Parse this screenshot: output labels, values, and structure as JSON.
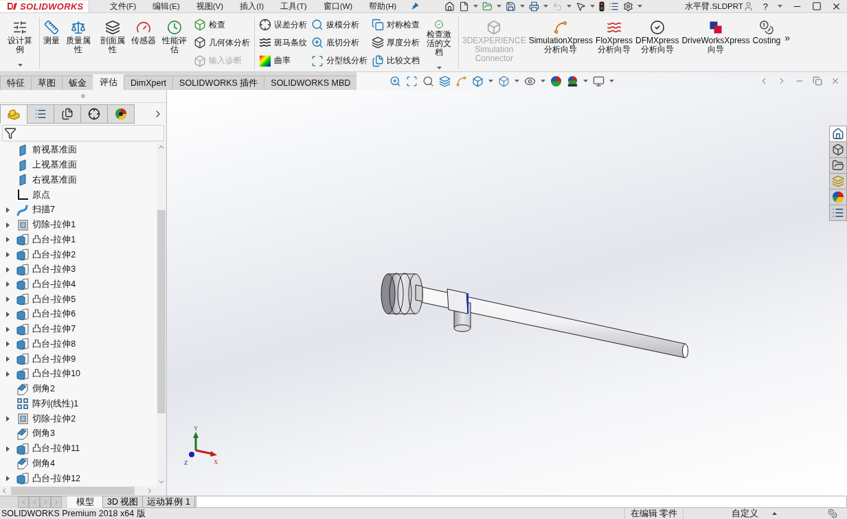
{
  "title_bar": {
    "logo": "SOLIDWORKS",
    "menus": [
      "文件(F)",
      "编辑(E)",
      "视图(V)",
      "插入(I)",
      "工具(T)",
      "窗口(W)",
      "帮助(H)"
    ],
    "document": "水平臂.SLDPRT",
    "help": "?"
  },
  "ribbon": [
    {
      "kind": "large",
      "label": "设计算例",
      "dropdown": true,
      "disabled": false
    },
    {
      "kind": "separator"
    },
    {
      "kind": "large",
      "label": "测量",
      "dropdown": false,
      "disabled": false
    },
    {
      "kind": "large",
      "label": "质量属性",
      "dropdown": false,
      "disabled": false
    },
    {
      "kind": "large",
      "label": "剖面属性",
      "dropdown": false,
      "disabled": false
    },
    {
      "kind": "large",
      "label": "传感器",
      "dropdown": false,
      "disabled": false
    },
    {
      "kind": "large",
      "label": "性能评估",
      "dropdown": false,
      "disabled": false
    },
    {
      "kind": "stack",
      "items": [
        {
          "label": "检查",
          "disabled": false
        },
        {
          "label": "几何体分析",
          "disabled": false
        },
        {
          "label": "输入诊断",
          "disabled": true
        }
      ]
    },
    {
      "kind": "separator"
    },
    {
      "kind": "stack",
      "items": [
        {
          "label": "误差分析",
          "disabled": false
        },
        {
          "label": "斑马条纹",
          "disabled": false
        },
        {
          "label": "曲率",
          "disabled": false
        }
      ]
    },
    {
      "kind": "stack",
      "items": [
        {
          "label": "拔模分析",
          "disabled": false
        },
        {
          "label": "底切分析",
          "disabled": false
        },
        {
          "label": "分型线分析",
          "disabled": false
        }
      ]
    },
    {
      "kind": "stack",
      "items": [
        {
          "label": "对称检查",
          "disabled": false
        },
        {
          "label": "厚度分析",
          "disabled": false
        },
        {
          "label": "比较文档",
          "disabled": false
        }
      ]
    },
    {
      "kind": "large",
      "label": "检查激活的文档",
      "dropdown": true,
      "disabled": false
    },
    {
      "kind": "separator"
    },
    {
      "kind": "large",
      "label": "3DEXPERIENCE Simulation Connector",
      "dropdown": false,
      "disabled": true
    },
    {
      "kind": "large",
      "label": "SimulationXpress 分析向导",
      "dropdown": false,
      "disabled": false
    },
    {
      "kind": "large",
      "label": "FloXpress 分析向导",
      "dropdown": false,
      "disabled": false
    },
    {
      "kind": "large",
      "label": "DFMXpress 分析向导",
      "dropdown": false,
      "disabled": false
    },
    {
      "kind": "large",
      "label": "DriveWorksXpress 向导",
      "dropdown": false,
      "disabled": false
    },
    {
      "kind": "large",
      "label": "Costing",
      "dropdown": false,
      "disabled": false
    }
  ],
  "ribbon_more": "»",
  "command_tabs": [
    {
      "label": "特征",
      "selected": false
    },
    {
      "label": "草图",
      "selected": false
    },
    {
      "label": "钣金",
      "selected": false
    },
    {
      "label": "评估",
      "selected": true
    },
    {
      "label": "DimXpert",
      "selected": false
    },
    {
      "label": "SOLIDWORKS 插件",
      "selected": false
    },
    {
      "label": "SOLIDWORKS MBD",
      "selected": false
    }
  ],
  "panel_tabs": [
    {
      "selected": true
    },
    {
      "selected": false
    },
    {
      "selected": false
    },
    {
      "selected": false
    },
    {
      "selected": false
    }
  ],
  "tree": [
    {
      "label": "前视基准面",
      "kind": "plane",
      "expandable": false
    },
    {
      "label": "上视基准面",
      "kind": "plane",
      "expandable": false
    },
    {
      "label": "右视基准面",
      "kind": "plane",
      "expandable": false
    },
    {
      "label": "原点",
      "kind": "origin",
      "expandable": false
    },
    {
      "label": "扫描7",
      "kind": "sweep",
      "expandable": true
    },
    {
      "label": "切除-拉伸1",
      "kind": "cut",
      "expandable": true
    },
    {
      "label": "凸台-拉伸1",
      "kind": "boss",
      "expandable": true
    },
    {
      "label": "凸台-拉伸2",
      "kind": "boss",
      "expandable": true
    },
    {
      "label": "凸台-拉伸3",
      "kind": "boss",
      "expandable": true
    },
    {
      "label": "凸台-拉伸4",
      "kind": "boss",
      "expandable": true
    },
    {
      "label": "凸台-拉伸5",
      "kind": "boss",
      "expandable": true
    },
    {
      "label": "凸台-拉伸6",
      "kind": "boss",
      "expandable": true
    },
    {
      "label": "凸台-拉伸7",
      "kind": "boss",
      "expandable": true
    },
    {
      "label": "凸台-拉伸8",
      "kind": "boss",
      "expandable": true
    },
    {
      "label": "凸台-拉伸9",
      "kind": "boss",
      "expandable": true
    },
    {
      "label": "凸台-拉伸10",
      "kind": "boss",
      "expandable": true
    },
    {
      "label": "倒角2",
      "kind": "chamfer",
      "expandable": false
    },
    {
      "label": "阵列(线性)1",
      "kind": "pattern",
      "expandable": false
    },
    {
      "label": "切除-拉伸2",
      "kind": "cut",
      "expandable": true
    },
    {
      "label": "倒角3",
      "kind": "chamfer",
      "expandable": false
    },
    {
      "label": "凸台-拉伸11",
      "kind": "boss",
      "expandable": true
    },
    {
      "label": "倒角4",
      "kind": "chamfer",
      "expandable": false
    },
    {
      "label": "凸台-拉伸12",
      "kind": "boss",
      "expandable": true
    }
  ],
  "triad": {
    "x": "X",
    "y": "Y",
    "z": "Z"
  },
  "task_pane": [
    {
      "selected": true
    },
    {
      "selected": false
    },
    {
      "selected": false
    },
    {
      "selected": false
    },
    {
      "selected": false
    },
    {
      "selected": false
    }
  ],
  "bottom_tabs": [
    {
      "label": "模型",
      "selected": true
    },
    {
      "label": "3D 视图",
      "selected": false
    },
    {
      "label": "运动算例 1",
      "selected": false
    }
  ],
  "status_bar": {
    "product": "SOLIDWORKS Premium 2018 x64 版",
    "mode": "在编辑 零件",
    "units": "自定义"
  }
}
